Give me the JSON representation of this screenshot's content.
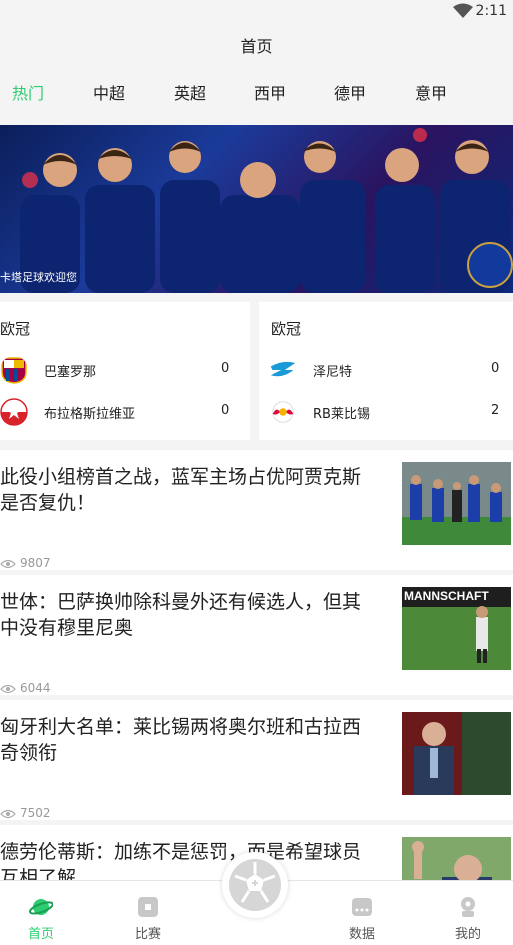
{
  "status_bar": {
    "time": "2:11"
  },
  "header": {
    "title": "首页"
  },
  "tabs": [
    {
      "label": "热门",
      "active": true
    },
    {
      "label": "中超",
      "active": false
    },
    {
      "label": "英超",
      "active": false
    },
    {
      "label": "西甲",
      "active": false
    },
    {
      "label": "德甲",
      "active": false
    },
    {
      "label": "意甲",
      "active": false
    }
  ],
  "banner": {
    "caption": "卡塔足球欢迎您"
  },
  "matches": [
    {
      "league": "欧冠",
      "teams": [
        {
          "name": "巴塞罗那",
          "score": "0",
          "logo": "barcelona-logo"
        },
        {
          "name": "布拉格斯拉维亚",
          "score": "0",
          "logo": "slavia-prague-logo"
        }
      ]
    },
    {
      "league": "欧冠",
      "teams": [
        {
          "name": "泽尼特",
          "score": "0",
          "logo": "zenit-logo"
        },
        {
          "name": "RB莱比锡",
          "score": "2",
          "logo": "rb-leipzig-logo"
        }
      ]
    }
  ],
  "news": [
    {
      "title": "此役小组榜首之战，蓝军主场占优阿贾克斯是否复仇！",
      "views": "9807",
      "thumb": "chelsea-match-photo"
    },
    {
      "title": "世体：巴萨换帅除科曼外还有候选人，但其中没有穆里尼奥",
      "views": "6044",
      "thumb": "coach-on-pitch-photo",
      "thumb_text": "MANNSCHAFT"
    },
    {
      "title": "匈牙利大名单：莱比锡两将奥尔班和古拉西奇领衔",
      "views": "7502",
      "thumb": "press-conference-photo"
    },
    {
      "title": "德劳伦蒂斯：加练不是惩罚，而是希望球员互相了解",
      "views": "",
      "thumb": "waving-man-photo"
    }
  ],
  "bottom_nav": [
    {
      "label": "首页",
      "icon": "planet-icon",
      "active": true
    },
    {
      "label": "比赛",
      "icon": "match-icon",
      "active": false
    },
    {
      "label": "数据",
      "icon": "data-icon",
      "active": false
    },
    {
      "label": "我的",
      "icon": "profile-icon",
      "active": false
    }
  ],
  "colors": {
    "accent": "#2ecc71",
    "background": "#f4f4f4",
    "muted": "#999999"
  }
}
